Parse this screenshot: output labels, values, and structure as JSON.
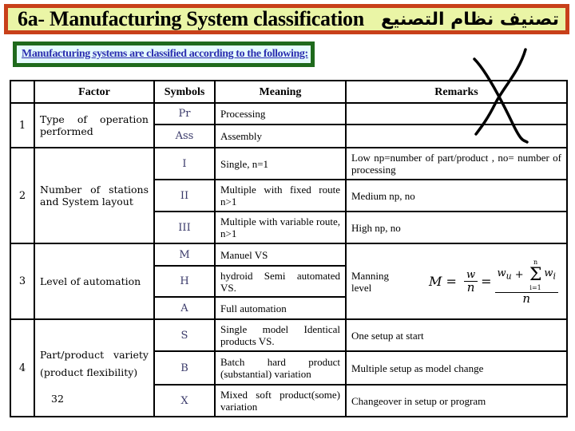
{
  "header": {
    "title_en": "6a- Manufacturing System classification",
    "title_ar": "تصنيف نظام التصنيع",
    "subtitle": "Manufacturing systems are classified according to the following:"
  },
  "colors": {
    "title_border": "#c8401a",
    "title_bg": "#eaf5a6",
    "subtitle_border": "#1f6a1c",
    "subtitle_bg": "#e6fbfd",
    "subtitle_text": "#2b2fb0"
  },
  "table": {
    "headers": {
      "factor": "Factor",
      "symbols": "Symbols",
      "meaning": "Meaning",
      "remarks": "Remarks"
    },
    "groups": [
      {
        "num": "1",
        "factor": "Type of operation performed",
        "rows": [
          {
            "symbol": "Pr",
            "meaning": "Processing",
            "remark": ""
          },
          {
            "symbol": "Ass",
            "meaning": "Assembly",
            "remark": ""
          }
        ]
      },
      {
        "num": "2",
        "factor": "Number of stations and System layout",
        "rows": [
          {
            "symbol": "I",
            "meaning": "Single, n=1",
            "remark": "Low np=number of part/product , no= number of processing"
          },
          {
            "symbol": "II",
            "meaning": "Multiple with fixed route n>1",
            "remark": "Medium np, no"
          },
          {
            "symbol": "III",
            "meaning": "Multiple with variable route, n>1",
            "remark": "High np, no"
          }
        ]
      },
      {
        "num": "3",
        "factor": "Level of automation",
        "rows": [
          {
            "symbol": "M",
            "meaning": "Manuel VS",
            "remark": ""
          },
          {
            "symbol": "H",
            "meaning": "hydroid Semi automated VS.",
            "remark": "Manning level"
          },
          {
            "symbol": "A",
            "meaning": "Full automation",
            "remark": ""
          }
        ],
        "formula": {
          "lhs": "M",
          "w": "w",
          "n": "n",
          "wu": "w",
          "wu_sub": "u",
          "wi": "w",
          "wi_sub": "i",
          "sum_upper": "n",
          "sum_lower": "i=1"
        }
      },
      {
        "num": "4",
        "factor": "Part/product variety (product flexibility)",
        "factor_extra": "32",
        "rows": [
          {
            "symbol": "S",
            "meaning": "Single model Identical products VS.",
            "remark": "One setup at start"
          },
          {
            "symbol": "B",
            "meaning": "Batch hard product (substantial) variation",
            "remark": "Multiple setup as model change"
          },
          {
            "symbol": "X",
            "meaning": "Mixed soft product(some) variation",
            "remark": "Changeover in setup or program"
          }
        ]
      }
    ]
  }
}
